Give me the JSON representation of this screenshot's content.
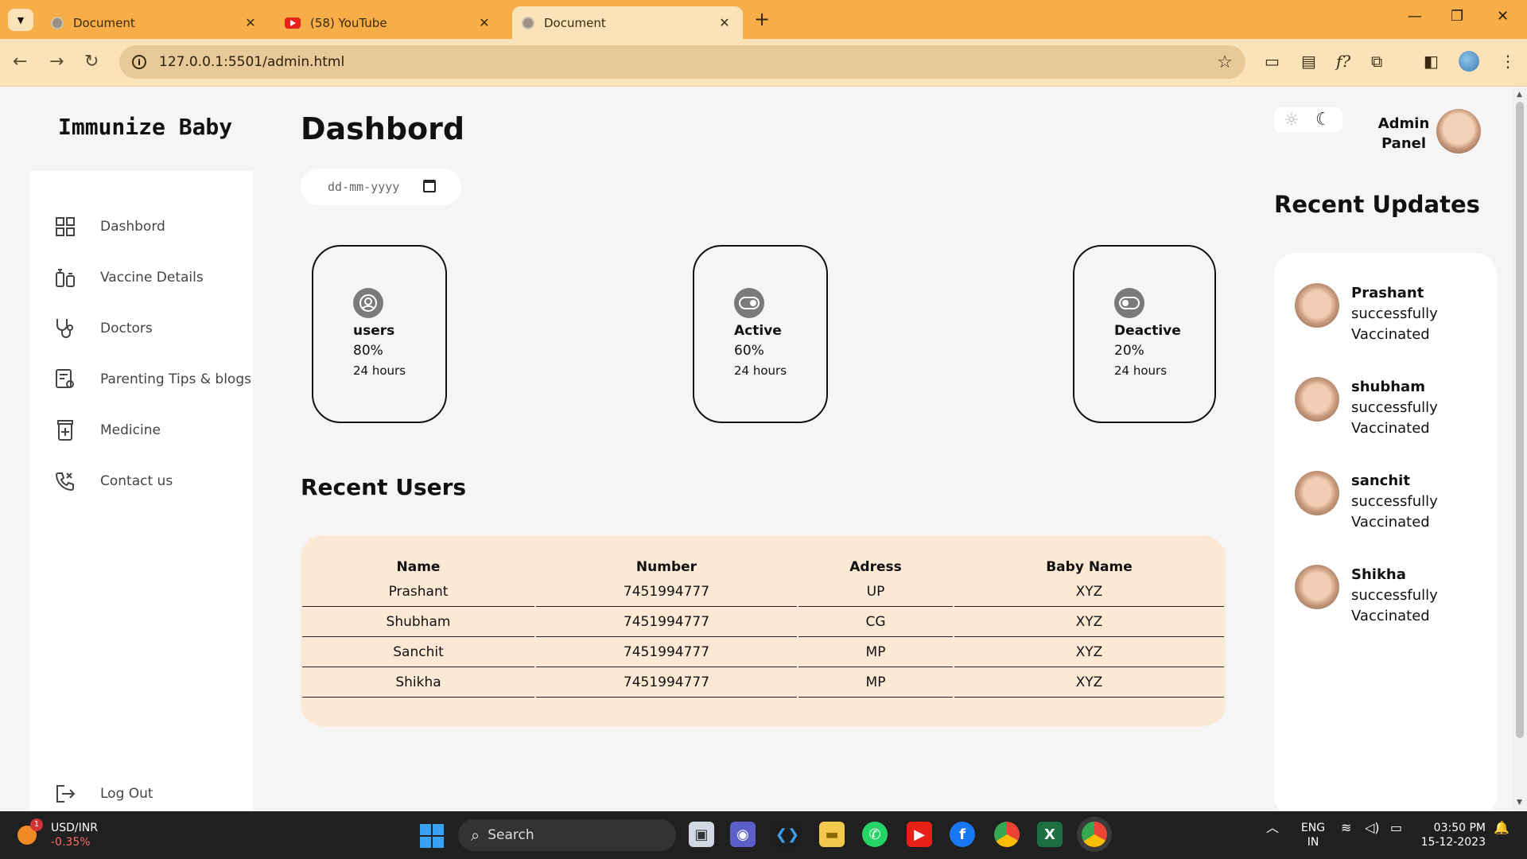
{
  "browser": {
    "tabs": [
      {
        "title": "Document",
        "active": false,
        "icon": "globe-icon"
      },
      {
        "title": "(58) YouTube",
        "active": false,
        "icon": "youtube-icon"
      },
      {
        "title": "Document",
        "active": true,
        "icon": "globe-icon"
      }
    ],
    "url": "127.0.0.1:5501/admin.html"
  },
  "brand": "Immunize Baby",
  "sidebar": {
    "items": [
      {
        "label": "Dashbord",
        "icon": "grid-icon"
      },
      {
        "label": "Vaccine Details",
        "icon": "vaccine-icon"
      },
      {
        "label": "Doctors",
        "icon": "stethoscope-icon"
      },
      {
        "label": "Parenting Tips & blogs",
        "icon": "blog-icon"
      },
      {
        "label": "Medicine",
        "icon": "medicine-icon"
      },
      {
        "label": "Contact us",
        "icon": "phone-icon"
      }
    ],
    "logout": {
      "label": "Log Out",
      "icon": "logout-icon"
    }
  },
  "main": {
    "title": "Dashbord",
    "date_placeholder": "dd-mm-yyyy",
    "cards": [
      {
        "title": "users",
        "value": "80%",
        "sub": "24 hours",
        "icon": "user-icon"
      },
      {
        "title": "Active",
        "value": "60%",
        "sub": "24 hours",
        "icon": "toggle-on-icon"
      },
      {
        "title": "Deactive",
        "value": "20%",
        "sub": "24 hours",
        "icon": "toggle-off-icon"
      }
    ],
    "recent_users_title": "Recent Users",
    "table": {
      "headers": [
        "Name",
        "Number",
        "Adress",
        "Baby Name"
      ],
      "rows": [
        [
          "Prashant",
          "7451994777",
          "UP",
          "XYZ"
        ],
        [
          "Shubham",
          "7451994777",
          "CG",
          "XYZ"
        ],
        [
          "Sanchit",
          "7451994777",
          "MP",
          "XYZ"
        ],
        [
          "Shikha",
          "7451994777",
          "MP",
          "XYZ"
        ]
      ]
    }
  },
  "right": {
    "admin_label_line1": "Admin",
    "admin_label_line2": "Panel",
    "updates_title": "Recent Updates",
    "updates": [
      {
        "name": "Prashant",
        "line2": "successfully",
        "line3": "Vaccinated"
      },
      {
        "name": "shubham",
        "line2": "successfully",
        "line3": "Vaccinated"
      },
      {
        "name": "sanchit",
        "line2": "successfully",
        "line3": "Vaccinated"
      },
      {
        "name": "Shikha",
        "line2": "successfully",
        "line3": "Vaccinated"
      }
    ]
  },
  "taskbar": {
    "widget_title": "USD/INR",
    "widget_change": "-0.35%",
    "widget_badge": "1",
    "search_label": "Search",
    "lang_line1": "ENG",
    "lang_line2": "IN",
    "time": "03:50 PM",
    "date": "15-12-2023"
  },
  "colors": {
    "tabbar": "#f7ad48",
    "toolbar": "#fbe3b9",
    "table_bg": "#fbe9d5"
  }
}
